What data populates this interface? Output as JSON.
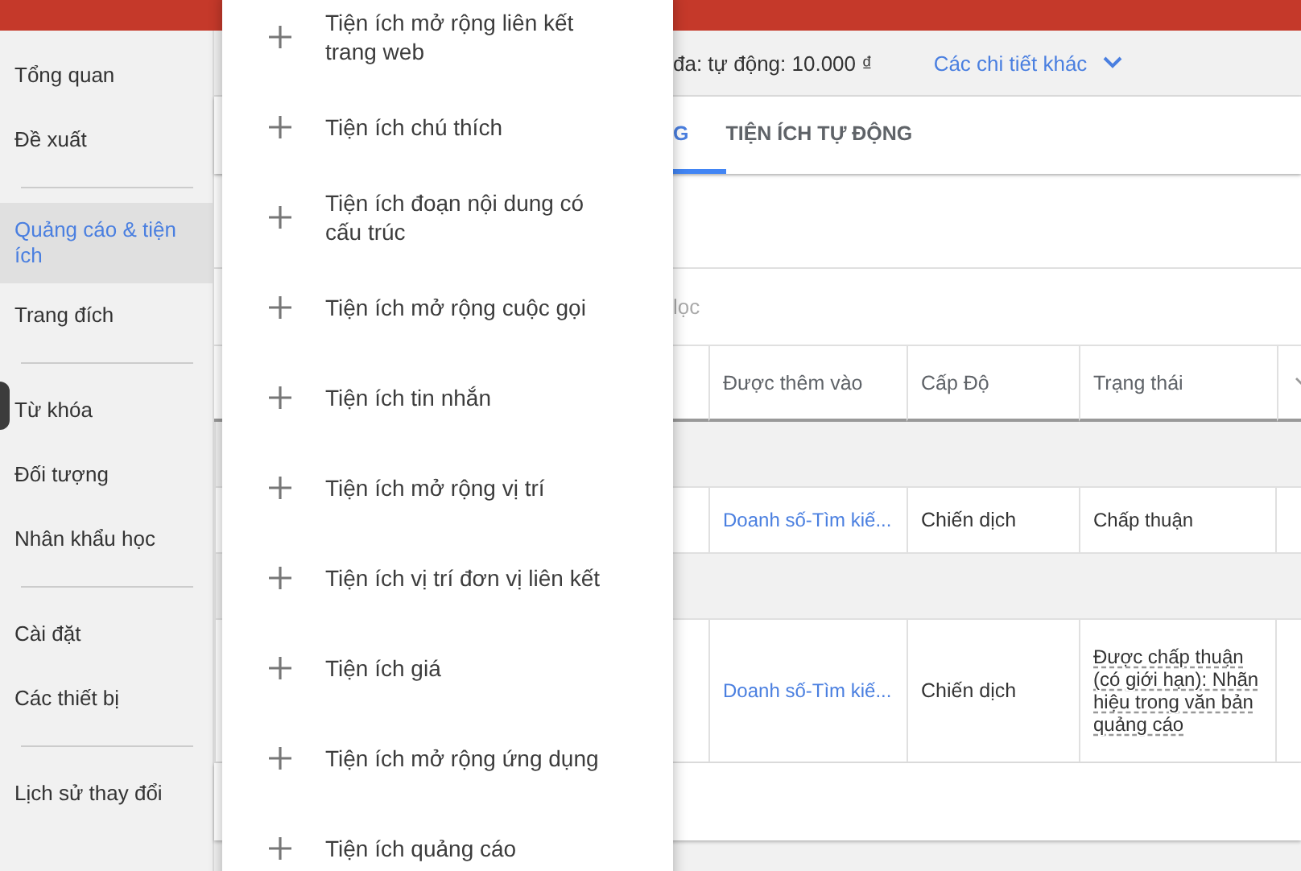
{
  "sidebar": {
    "groups": [
      [
        {
          "label": "Tổng quan",
          "selected": false
        },
        {
          "label": "Đề xuất",
          "selected": false
        }
      ],
      [
        {
          "label": "Quảng cáo & tiện ích",
          "selected": true
        },
        {
          "label": "Trang đích",
          "selected": false
        }
      ],
      [
        {
          "label": "Từ khóa",
          "selected": false
        },
        {
          "label": "Đối tượng",
          "selected": false
        },
        {
          "label": "Nhân khẩu học",
          "selected": false
        }
      ],
      [
        {
          "label": "Cài đặt",
          "selected": false
        },
        {
          "label": "Các thiết bị",
          "selected": false
        }
      ],
      [
        {
          "label": "Lịch sử thay đổi",
          "selected": false
        }
      ]
    ]
  },
  "info_bar": {
    "budget": "đa: tự động: 10.000 ₫",
    "details_link": "Các chi tiết khác"
  },
  "tabs": [
    {
      "label": "G",
      "selected": true
    },
    {
      "label": "TIỆN ÍCH TỰ ĐỘNG",
      "selected": false
    }
  ],
  "filter": {
    "placeholder": "lọc"
  },
  "table": {
    "columns": [
      "Được thêm vào",
      "Cấp Độ",
      "Trạng thái"
    ],
    "rows": [
      {
        "kind": "group"
      },
      {
        "kind": "data",
        "added_to": "Doanh số-Tìm kiế...",
        "level": "Chiến dịch",
        "status": "Chấp thuận",
        "status_has_details": false
      },
      {
        "kind": "group"
      },
      {
        "kind": "data",
        "added_to": "Doanh số-Tìm kiế...",
        "level": "Chiến dịch",
        "status": "Được chấp thuận (có giới hạn): Nhãn hiệu trong văn bản quảng cáo",
        "status_has_details": true
      }
    ]
  },
  "menu": {
    "items": [
      "Tiện ích mở rộng liên kết trang web",
      "Tiện ích chú thích",
      "Tiện ích đoạn nội dung có cấu trúc",
      "Tiện ích mở rộng cuộc gọi",
      "Tiện ích tin nhắn",
      "Tiện ích mở rộng vị trí",
      "Tiện ích vị trí đơn vị liên kết",
      "Tiện ích giá",
      "Tiện ích mở rộng ứng dụng",
      "Tiện ích quảng cáo"
    ]
  }
}
